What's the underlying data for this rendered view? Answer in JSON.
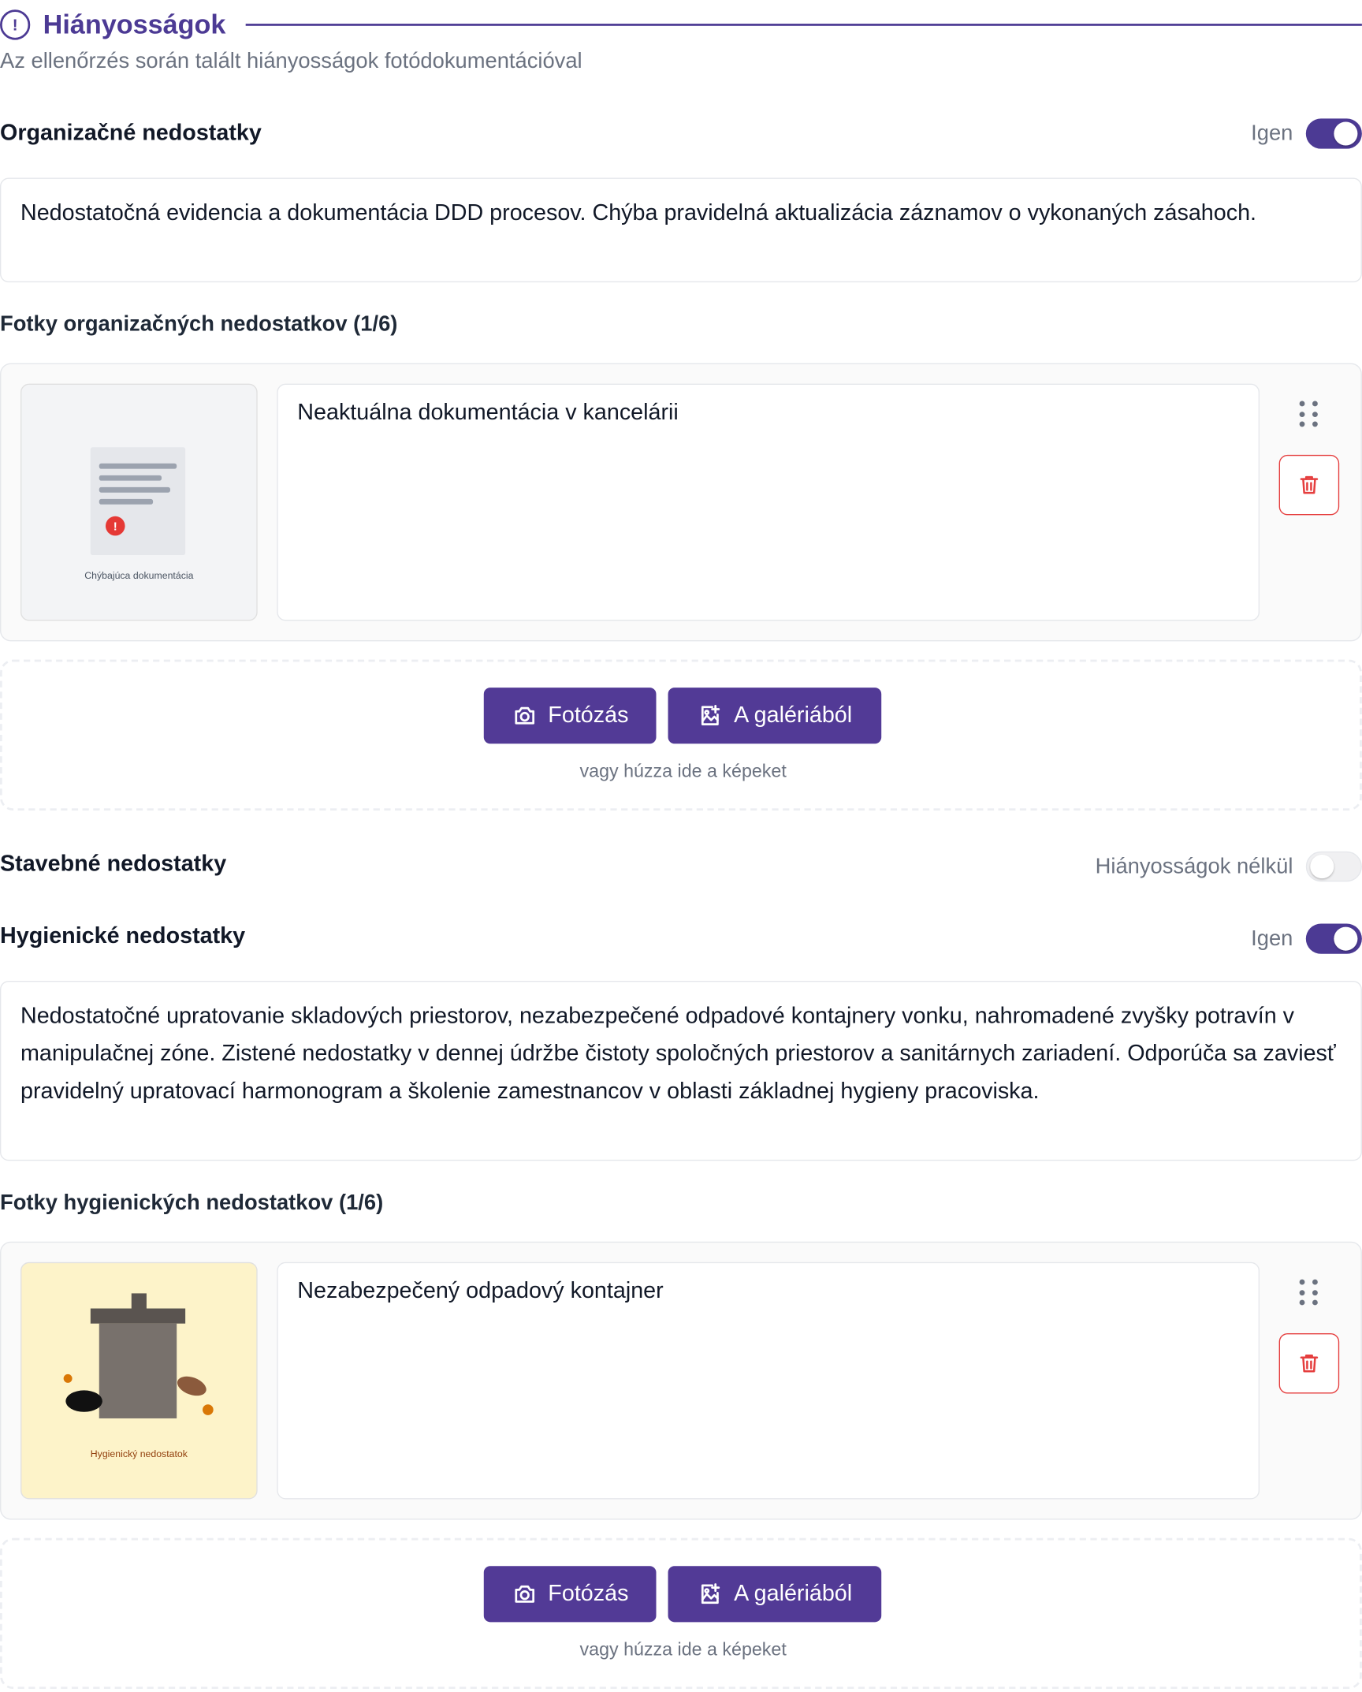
{
  "section": {
    "title": "Hiányosságok",
    "subtitle": "Az ellenőrzés során talált hiányosságok fotódokumentációval"
  },
  "organizational": {
    "label": "Organizačné nedostatky",
    "toggle_label": "Igen",
    "toggle_on": true,
    "description": "Nedostatočná evidencia a dokumentácia DDD procesov. Chýba pravidelná aktualizácia záznamov o vykonaných zásahoch.",
    "photos_label": "Fotky organizačných nedostatkov (1/6)",
    "photos": [
      {
        "thumb_label": "Chýbajúca dokumentácia",
        "caption": "Neaktuálna dokumentácia v kancelárii"
      }
    ],
    "take_photo_label": "Fotózás",
    "gallery_label": "A galériából",
    "drop_hint": "vagy húzza ide a képeket"
  },
  "construction": {
    "label": "Stavebné nedostatky",
    "toggle_label": "Hiányosságok nélkül",
    "toggle_on": false
  },
  "hygienic": {
    "label": "Hygienické nedostatky",
    "toggle_label": "Igen",
    "toggle_on": true,
    "description": "Nedostatočné upratovanie skladových priestorov, nezabezpečené odpadové kontajnery vonku, nahromadené zvyšky potravín v manipulačnej zóne. Zistené nedostatky v dennej údržbe čistoty spoločných priestorov a sanitárnych zariadení. Odporúča sa zaviesť pravidelný upratovací harmonogram a školenie zamestnancov v oblasti základnej hygieny pracoviska.",
    "photos_label": "Fotky hygienických nedostatkov (1/6)",
    "photos": [
      {
        "thumb_label": "Hygienický nedostatok",
        "caption": "Nezabezpečený odpadový kontajner"
      }
    ],
    "take_photo_label": "Fotózás",
    "gallery_label": "A galériából",
    "drop_hint": "vagy húzza ide a képeket"
  },
  "colors": {
    "primary": "#4c3a94",
    "button": "#523a96",
    "danger": "#e53e3e",
    "muted_text": "#6b7280"
  }
}
